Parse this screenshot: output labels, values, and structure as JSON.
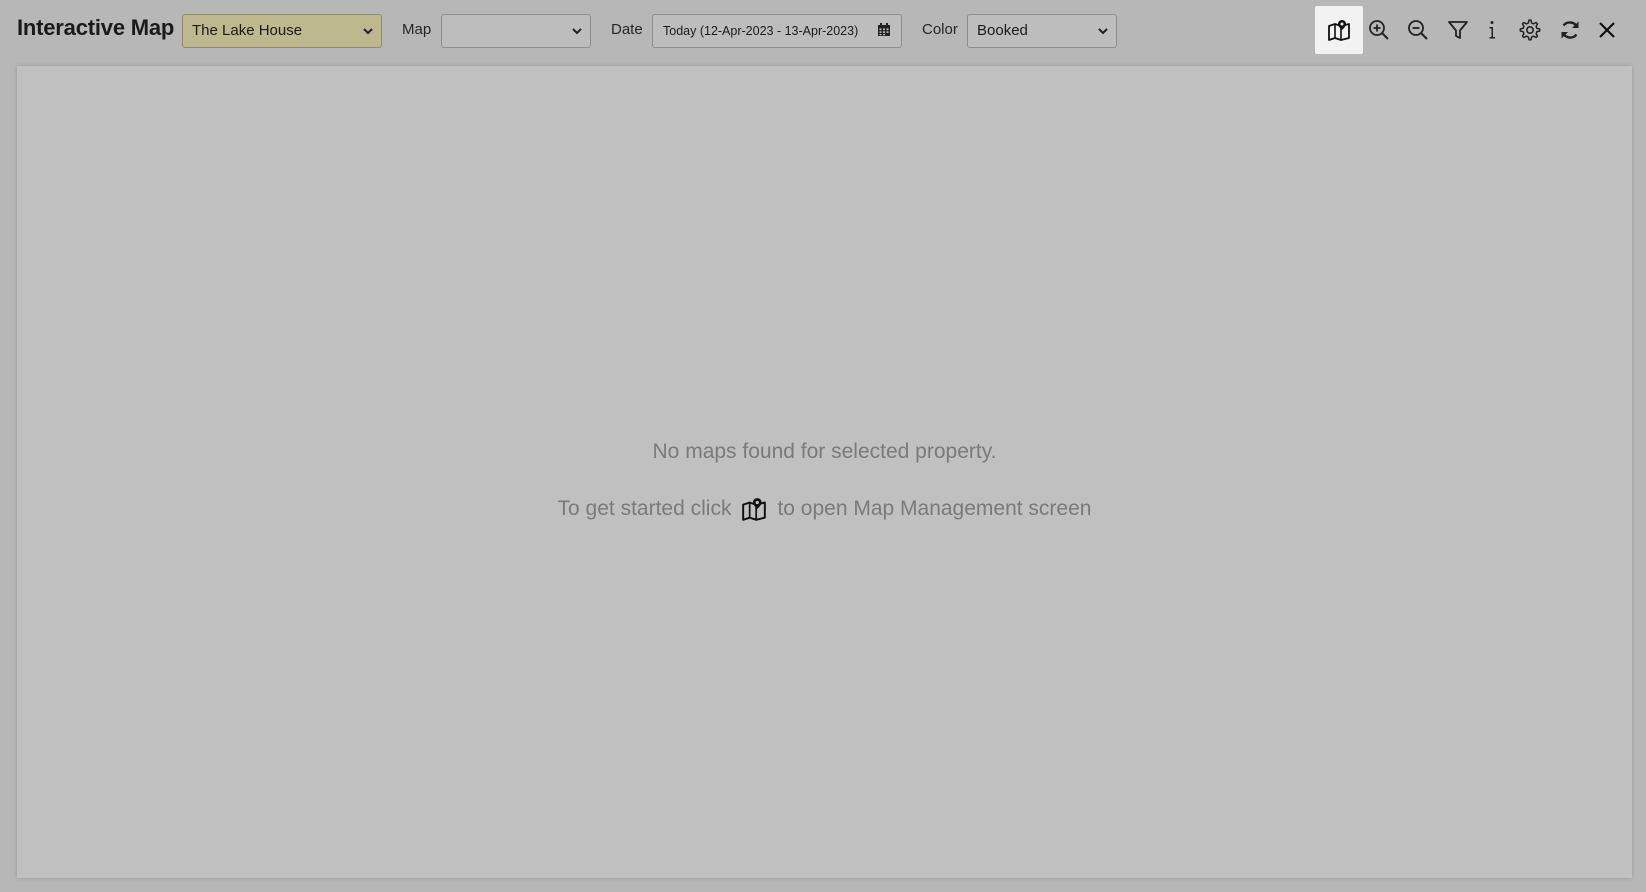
{
  "header": {
    "title": "Interactive Map"
  },
  "filters": {
    "property_value": "The Lake House",
    "map_label": "Map",
    "map_value": "",
    "date_label": "Date",
    "date_value": "Today (12-Apr-2023 - 13-Apr-2023)",
    "color_label": "Color",
    "color_value": "Booked"
  },
  "toolbar_icons": [
    "map-management-icon",
    "zoom-in-icon",
    "zoom-out-icon",
    "filter-icon",
    "info-icon",
    "settings-icon",
    "refresh-icon",
    "close-icon"
  ],
  "empty_state": {
    "line1": "No maps found for selected property.",
    "line2_before": "To get started click",
    "line2_after": "to open Map Management screen"
  },
  "colors": {
    "background": "#b7b7b7",
    "canvas": "#c0c0c0",
    "property_select": "#bdb88d",
    "active_button": "#f2f2f2"
  }
}
